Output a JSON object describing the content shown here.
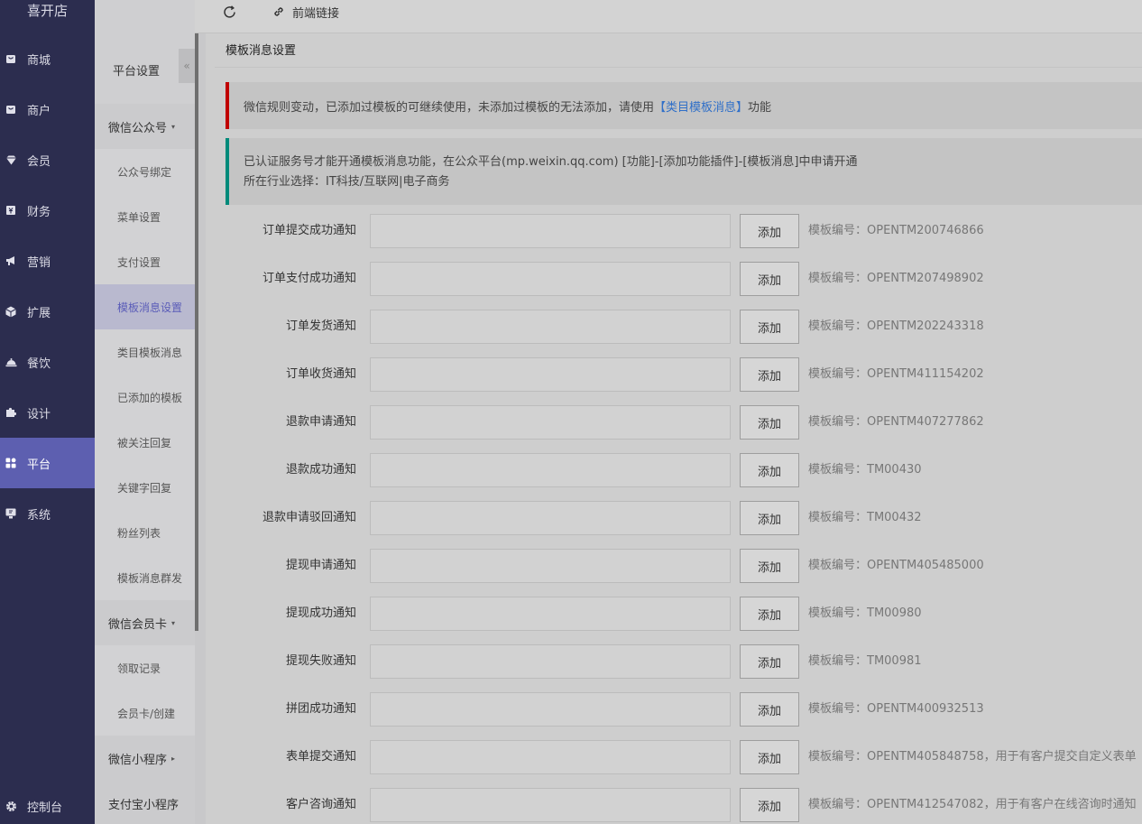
{
  "brand": "喜开店",
  "nav": {
    "items": [
      {
        "label": "商城",
        "icon": "store-icon"
      },
      {
        "label": "商户",
        "icon": "merchant-icon"
      },
      {
        "label": "会员",
        "icon": "member-icon"
      },
      {
        "label": "财务",
        "icon": "finance-icon"
      },
      {
        "label": "营销",
        "icon": "megaphone-icon"
      },
      {
        "label": "扩展",
        "icon": "box-icon"
      },
      {
        "label": "餐饮",
        "icon": "dining-icon"
      },
      {
        "label": "设计",
        "icon": "puzzle-icon"
      },
      {
        "label": "平台",
        "icon": "grid-icon"
      },
      {
        "label": "系统",
        "icon": "monitor-icon"
      }
    ],
    "active": "平台",
    "bottom": "控制台"
  },
  "subnav": {
    "title": "平台设置",
    "collapse": "«",
    "groups": [
      {
        "label": "微信公众号",
        "arrow": "▾"
      },
      {
        "label": "微信会员卡",
        "arrow": "▾"
      },
      {
        "label": "微信小程序",
        "arrow": "▸"
      },
      {
        "label": "支付宝小程序",
        "arrow": ""
      }
    ],
    "subs": [
      "公众号绑定",
      "菜单设置",
      "支付设置",
      "模板消息设置",
      "类目模板消息",
      "已添加的模板",
      "被关注回复",
      "关键字回复",
      "粉丝列表",
      "模板消息群发",
      "领取记录",
      "会员卡/创建"
    ],
    "active": "模板消息设置"
  },
  "topbar": {
    "frontend_link": "前端链接"
  },
  "page": {
    "title": "模板消息设置",
    "notice_red_pre": "微信规则变动，已添加过模板的可继续使用，未添加过模板的无法添加，请使用",
    "notice_red_link": "【类目模板消息】",
    "notice_red_post": "功能",
    "notice_green_line1": "已认证服务号才能开通模板消息功能，在公众平台(mp.weixin.qq.com) [功能]-[添加功能插件]-[模板消息]中申请开通",
    "notice_green_line2": "所在行业选择：IT科技/互联网|电子商务",
    "add_label": "添加",
    "rows": [
      {
        "label": "订单提交成功通知",
        "value": "",
        "code": "模板编号：OPENTM200746866"
      },
      {
        "label": "订单支付成功通知",
        "value": "",
        "code": "模板编号：OPENTM207498902"
      },
      {
        "label": "订单发货通知",
        "value": "",
        "code": "模板编号：OPENTM202243318"
      },
      {
        "label": "订单收货通知",
        "value": "",
        "code": "模板编号：OPENTM411154202"
      },
      {
        "label": "退款申请通知",
        "value": "",
        "code": "模板编号：OPENTM407277862"
      },
      {
        "label": "退款成功通知",
        "value": "",
        "code": "模板编号：TM00430"
      },
      {
        "label": "退款申请驳回通知",
        "value": "",
        "code": "模板编号：TM00432"
      },
      {
        "label": "提现申请通知",
        "value": "",
        "code": "模板编号：OPENTM405485000"
      },
      {
        "label": "提现成功通知",
        "value": "",
        "code": "模板编号：TM00980"
      },
      {
        "label": "提现失败通知",
        "value": "",
        "code": "模板编号：TM00981"
      },
      {
        "label": "拼团成功通知",
        "value": "",
        "code": "模板编号：OPENTM400932513"
      },
      {
        "label": "表单提交通知",
        "value": "",
        "code": "模板编号：OPENTM405848758，用于有客户提交自定义表单"
      },
      {
        "label": "客户咨询通知",
        "value": "",
        "code": "模板编号：OPENTM412547082，用于有客户在线咨询时通知"
      }
    ]
  }
}
